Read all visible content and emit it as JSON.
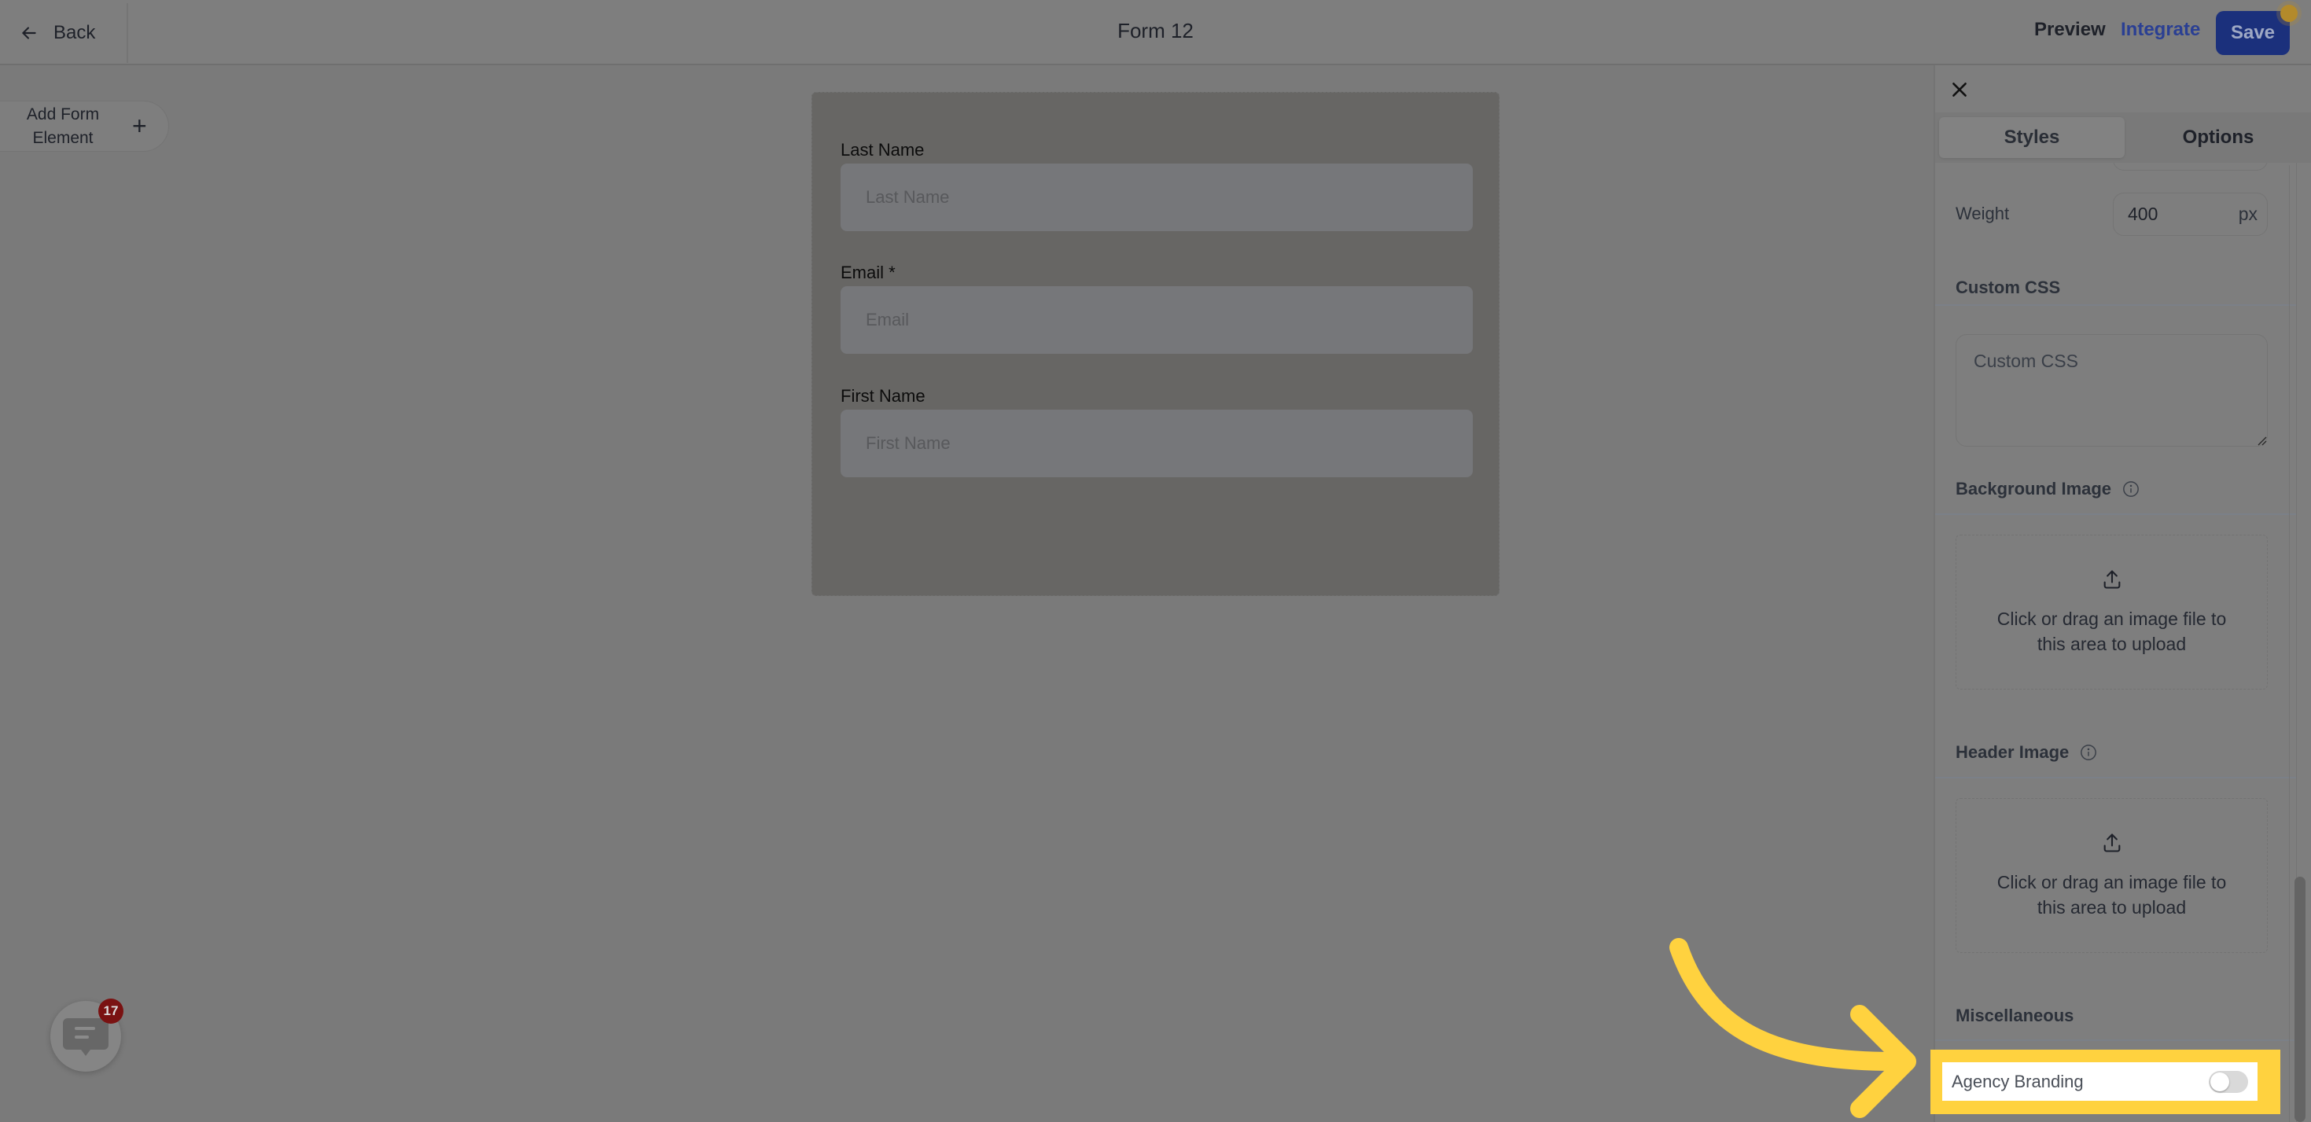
{
  "header": {
    "back_label": "Back",
    "title": "Form 12",
    "preview_label": "Preview",
    "integrate_label": "Integrate",
    "save_label": "Save"
  },
  "canvas": {
    "add_element_label": "Add Form Element",
    "fields": [
      {
        "label": "Last Name",
        "placeholder": "Last Name"
      },
      {
        "label": "Email *",
        "placeholder": "Email"
      },
      {
        "label": "First Name",
        "placeholder": "First Name"
      }
    ]
  },
  "panel": {
    "tabs": [
      {
        "label": "Styles",
        "active": true
      },
      {
        "label": "Options",
        "active": false
      }
    ],
    "weight": {
      "label": "Weight",
      "value": "400",
      "unit": "px"
    },
    "custom_css": {
      "label": "Custom CSS",
      "placeholder": "Custom CSS"
    },
    "background_image": {
      "label": "Background Image",
      "upload_text": "Click or drag an image file to this area to upload"
    },
    "header_image": {
      "label": "Header Image",
      "upload_text": "Click or drag an image file to this area to upload"
    },
    "miscellaneous": {
      "label": "Miscellaneous"
    },
    "agency_branding": {
      "label": "Agency Branding",
      "enabled": false
    }
  },
  "chat_widget": {
    "badge_count": "17"
  },
  "colors": {
    "accent": "#1b307c",
    "highlight": "#ffd23f",
    "badge": "#7a1212",
    "integrate": "#2a3f93"
  }
}
